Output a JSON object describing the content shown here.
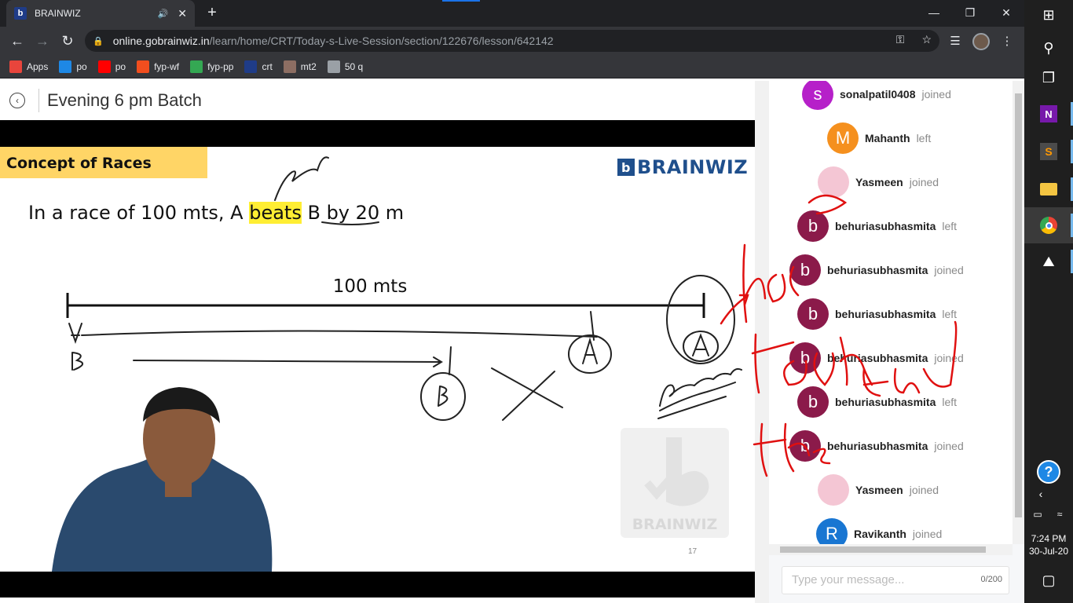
{
  "browser": {
    "tab_title": "BRAINWIZ",
    "tab_favicon": "b",
    "url_host": "online.gobrainwiz.in",
    "url_path": "/learn/home/CRT/Today-s-Live-Session/section/122676/lesson/642142",
    "bookmarks": [
      {
        "label": "Apps",
        "icon": "apps-grid-icon",
        "color": "#e8453c"
      },
      {
        "label": "po",
        "icon": "ie-icon",
        "color": "#1e88e5"
      },
      {
        "label": "po",
        "icon": "youtube-icon",
        "color": "#ff0000"
      },
      {
        "label": "fyp-wf",
        "icon": "figma-icon",
        "color": "#f24e1e"
      },
      {
        "label": "fyp-pp",
        "icon": "graph-icon",
        "color": "#34a853"
      },
      {
        "label": "crt",
        "icon": "brainwiz-icon",
        "color": "#1f3c88"
      },
      {
        "label": "mt2",
        "icon": "cc-icon",
        "color": "#8d6e63"
      },
      {
        "label": "50 q",
        "icon": "globe-icon",
        "color": "#9aa0a6"
      }
    ]
  },
  "page": {
    "title": "Evening 6 pm Batch"
  },
  "slide": {
    "section_label": "Concept of Races",
    "brand": "BRAINWIZ",
    "question_pre": "In a race of 100 mts, A ",
    "question_highlight": "beats",
    "question_post": " B by 20 m",
    "distance_label": "100 mts",
    "page_number": "17",
    "watermark": "BRAINWIZ"
  },
  "chat": {
    "messages": [
      {
        "initial": "s",
        "name": "sonalpatil0408",
        "action": "joined",
        "color": "#b620c9"
      },
      {
        "initial": "M",
        "name": "Mahanth",
        "action": "left",
        "color": "#f5901e"
      },
      {
        "initial": "",
        "name": "Yasmeen",
        "action": "joined",
        "color": "#f4c6d4"
      },
      {
        "initial": "b",
        "name": "behuriasubhasmita",
        "action": "left",
        "color": "#8b1a4a"
      },
      {
        "initial": "b",
        "name": "behuriasubhasmita",
        "action": "joined",
        "color": "#8b1a4a"
      },
      {
        "initial": "b",
        "name": "behuriasubhasmita",
        "action": "left",
        "color": "#8b1a4a"
      },
      {
        "initial": "b",
        "name": "behuriasubhasmita",
        "action": "joined",
        "color": "#8b1a4a"
      },
      {
        "initial": "b",
        "name": "behuriasubhasmita",
        "action": "left",
        "color": "#8b1a4a"
      },
      {
        "initial": "b",
        "name": "behuriasubhasmita",
        "action": "joined",
        "color": "#8b1a4a"
      },
      {
        "initial": "",
        "name": "Yasmeen",
        "action": "joined",
        "color": "#f4c6d4"
      },
      {
        "initial": "R",
        "name": "Ravikanth",
        "action": "joined",
        "color": "#1976d2"
      }
    ],
    "input_placeholder": "Type your message...",
    "char_count": "0/200"
  },
  "taskbar": {
    "time": "7:24 PM",
    "date": "30-Jul-20"
  }
}
